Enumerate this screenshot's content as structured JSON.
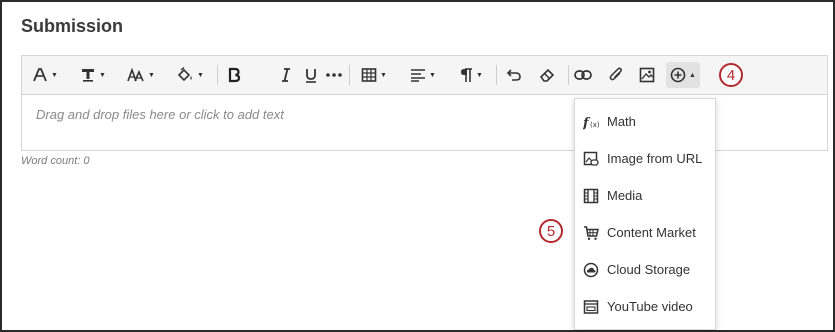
{
  "section": {
    "title": "Submission"
  },
  "editor": {
    "placeholder": "Drag and drop files here or click to add text",
    "word_count": "Word count: 0"
  },
  "toolbar": {
    "buttons": [
      {
        "icon": "paragraph-style-icon",
        "has_dropdown": true
      },
      {
        "icon": "text-format-icon",
        "has_dropdown": true
      },
      {
        "icon": "font-size-icon",
        "has_dropdown": true
      },
      {
        "icon": "fill-color-icon",
        "has_dropdown": true
      },
      {
        "icon": "bold-icon",
        "has_dropdown": false
      },
      {
        "icon": "italic-icon",
        "has_dropdown": false
      },
      {
        "icon": "underline-icon",
        "has_dropdown": false
      },
      {
        "icon": "more-icon",
        "has_dropdown": false
      },
      {
        "icon": "table-icon",
        "has_dropdown": true
      },
      {
        "icon": "align-icon",
        "has_dropdown": true
      },
      {
        "icon": "paragraph-mark-icon",
        "has_dropdown": true
      },
      {
        "icon": "undo-icon",
        "has_dropdown": false
      },
      {
        "icon": "eraser-icon",
        "has_dropdown": false
      },
      {
        "icon": "link-icon",
        "has_dropdown": false
      },
      {
        "icon": "attachment-icon",
        "has_dropdown": false
      },
      {
        "icon": "image-icon",
        "has_dropdown": false
      },
      {
        "icon": "add-content-icon",
        "has_dropdown": true,
        "active": true
      }
    ]
  },
  "callouts": {
    "first": "4",
    "second": "5"
  },
  "insert_menu": {
    "items": [
      {
        "label": "Math",
        "icon": "math-function-icon"
      },
      {
        "label": "Image from URL",
        "icon": "image-url-icon"
      },
      {
        "label": "Media",
        "icon": "media-film-icon"
      },
      {
        "label": "Content Market",
        "icon": "shopping-cart-icon"
      },
      {
        "label": "Cloud Storage",
        "icon": "cloud-storage-icon"
      },
      {
        "label": "YouTube video",
        "icon": "video-player-icon"
      }
    ]
  },
  "colors": {
    "callout": "#b2292e",
    "toolbar_bg": "#f5f5f5"
  }
}
